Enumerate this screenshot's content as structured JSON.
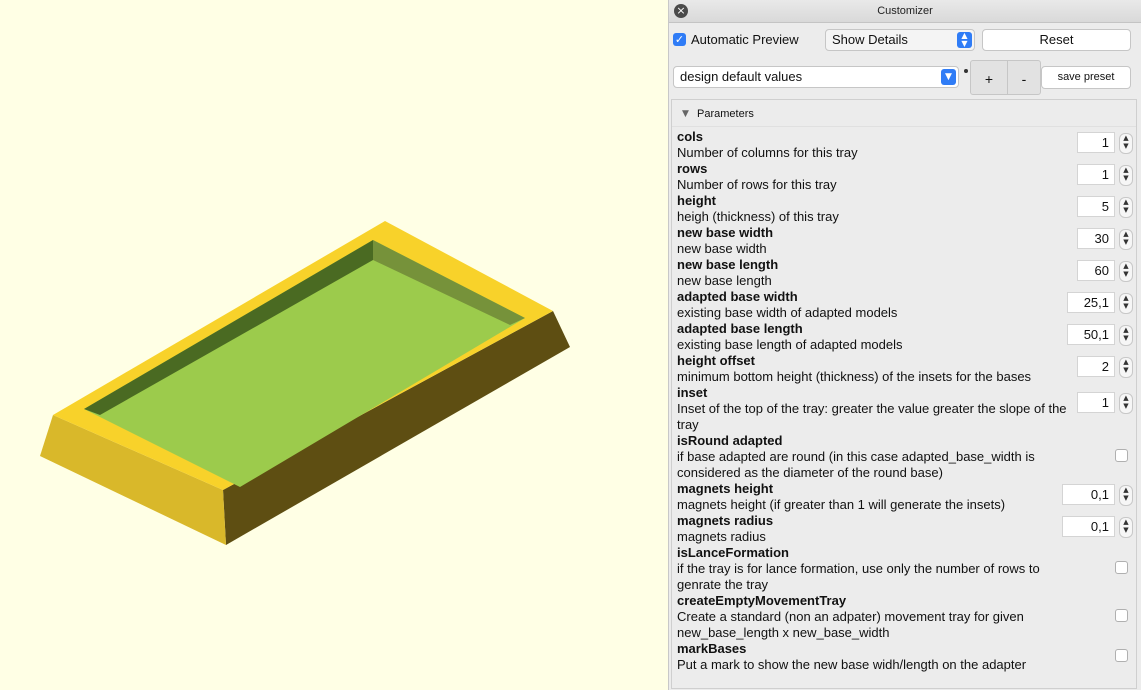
{
  "window": {
    "title": "Customizer"
  },
  "toolbar": {
    "automatic_preview_label": "Automatic Preview",
    "automatic_preview_checked": true,
    "show_details_value": "Show Details",
    "reset_label": "Reset"
  },
  "presets": {
    "selected": "design default values",
    "plus_label": "+",
    "minus_label": "-",
    "save_label": "save preset"
  },
  "parameters_section": {
    "label": "Parameters"
  },
  "parameters": [
    {
      "name": "cols",
      "desc": "Number of columns for this tray",
      "value": "1",
      "type": "number"
    },
    {
      "name": "rows",
      "desc": "Number of rows for this tray",
      "value": "1",
      "type": "number"
    },
    {
      "name": "height",
      "desc": "heigh (thickness) of this tray",
      "value": "5",
      "type": "number"
    },
    {
      "name": "new base width",
      "desc": "new base width",
      "value": "30",
      "type": "number"
    },
    {
      "name": "new base length",
      "desc": "new base length",
      "value": "60",
      "type": "number"
    },
    {
      "name": "adapted base width",
      "desc": "existing base width of adapted models",
      "value": "25,1",
      "type": "number"
    },
    {
      "name": "adapted base length",
      "desc": "existing base length of adapted models",
      "value": "50,1",
      "type": "number"
    },
    {
      "name": "height offset",
      "desc": "minimum bottom height (thickness) of the insets for the bases",
      "value": "2",
      "type": "number"
    },
    {
      "name": "inset",
      "desc": "Inset of the top of the tray: greater the value greater the slope of the tray",
      "value": "1",
      "type": "number"
    },
    {
      "name": "isRound adapted",
      "desc": "if base adapted are round (in this case adapted_base_width is considered as the diameter of the round base)",
      "checked": false,
      "type": "checkbox"
    },
    {
      "name": "magnets height",
      "desc": "magnets height (if greater than 1 will generate the insets)",
      "value": "0,1",
      "type": "number"
    },
    {
      "name": "magnets radius",
      "desc": "magnets radius",
      "value": "0,1",
      "type": "number"
    },
    {
      "name": "isLanceFormation",
      "desc": "if the tray is for lance formation, use only the number of rows to genrate the tray",
      "checked": false,
      "type": "checkbox"
    },
    {
      "name": "createEmptyMovementTray",
      "desc": "Create a standard (non an adpater) movement tray for given new_base_length x new_base_width",
      "checked": false,
      "type": "checkbox"
    },
    {
      "name": "markBases",
      "desc": "Put a mark to show the new base widh/length on the adapter",
      "checked": false,
      "type": "checkbox"
    }
  ],
  "colors": {
    "viewport_bg": "#ffffe5",
    "tray_top": "#f8d22a",
    "tray_left": "#d9b82a",
    "tray_right": "#5e4e12",
    "tray_floor": "#9ccb4c",
    "inner_wall_dark": "#4a6a22",
    "inner_wall_mid": "#76923a",
    "accent": "#2f7cf6"
  }
}
